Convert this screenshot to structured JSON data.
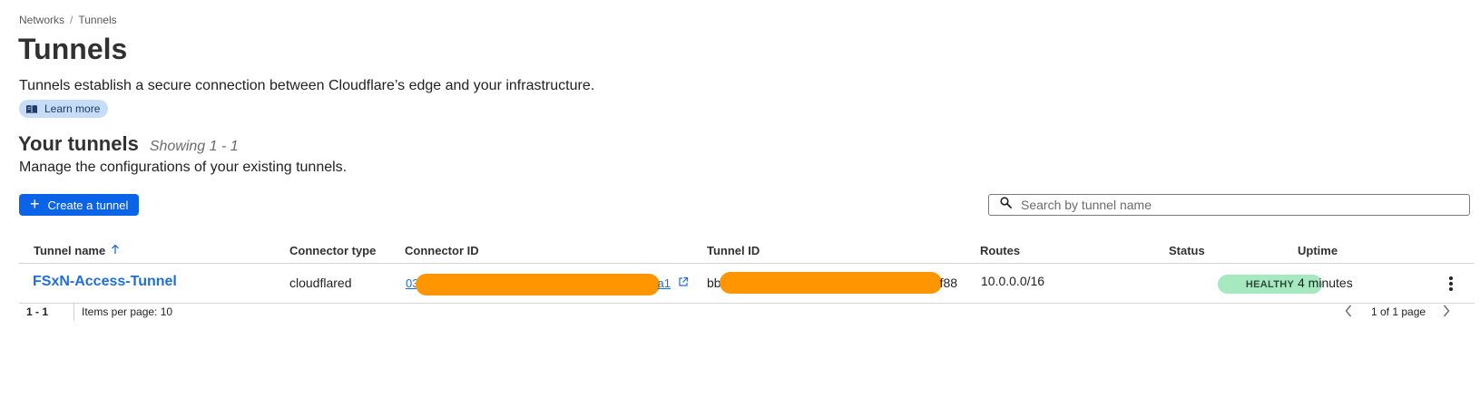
{
  "breadcrumb": {
    "parent": "Networks",
    "separator": "/",
    "current": "Tunnels"
  },
  "header": {
    "title": "Tunnels",
    "description": "Tunnels establish a secure connection between Cloudflare’s edge and your infrastructure.",
    "learn_more": "Learn more"
  },
  "section": {
    "title": "Your tunnels",
    "showing": "Showing 1 - 1",
    "description": "Manage the configurations of your existing tunnels.",
    "create_label": "Create a tunnel"
  },
  "search": {
    "placeholder": "Search by tunnel name",
    "value": ""
  },
  "table": {
    "columns": {
      "name": "Tunnel name",
      "connector_type": "Connector type",
      "connector_id": "Connector ID",
      "tunnel_id": "Tunnel ID",
      "routes": "Routes",
      "status": "Status",
      "uptime": "Uptime"
    },
    "sort": {
      "column": "Tunnel name",
      "direction": "ascending",
      "icon": "arrow-up-icon"
    },
    "rows": [
      {
        "name": "FSxN-Access-Tunnel",
        "connector_type": "cloudflared",
        "connector_id_prefix": "03",
        "connector_id_suffix": "a1",
        "tunnel_id_prefix": "bb",
        "tunnel_id_suffix": "f88",
        "routes": "10.0.0.0/16",
        "status": "HEALTHY",
        "uptime": "4 minutes"
      }
    ]
  },
  "pagination": {
    "range": "1 - 1",
    "items_per_page": "Items per page: 10",
    "pages": "1 of 1 page"
  },
  "colors": {
    "accent": "#0b63e8",
    "link": "#1f6fd8",
    "healthy_badge": "#a6e8bf",
    "redaction": "#ff9500",
    "learn_more_bg": "#c7dcf7"
  }
}
